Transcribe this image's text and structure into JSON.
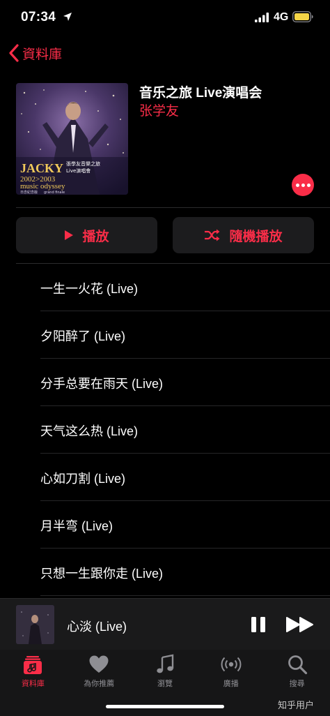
{
  "status_bar": {
    "time": "07:34",
    "network": "4G",
    "battery_color": "#f5d547"
  },
  "nav": {
    "back_label": "資料庫",
    "accent_color": "#fa2d48"
  },
  "album": {
    "title": "音乐之旅 Live演唱会",
    "artist": "张学友",
    "art_text": {
      "artist_name": "JACKY",
      "chinese_title": "張學友音樂之旅",
      "chinese_subtitle": "Live演唱會",
      "years": "2002>2003",
      "tour_name": "music odyssey",
      "edition": "日念紀念版",
      "finale": "grand finale"
    }
  },
  "actions": {
    "play_label": "播放",
    "shuffle_label": "隨機播放"
  },
  "tracks": [
    {
      "title": "一生一火花 (Live)"
    },
    {
      "title": "夕阳醉了 (Live)"
    },
    {
      "title": "分手总要在雨天 (Live)"
    },
    {
      "title": "天气这么热 (Live)"
    },
    {
      "title": "心如刀割 (Live)"
    },
    {
      "title": "月半弯 (Live)"
    },
    {
      "title": "只想一生跟你走 (Live)"
    }
  ],
  "now_playing": {
    "title": "心淡 (Live)"
  },
  "tabs": [
    {
      "label": "資料庫",
      "icon": "library-icon",
      "active": true
    },
    {
      "label": "為你推薦",
      "icon": "heart-icon",
      "active": false
    },
    {
      "label": "瀏覽",
      "icon": "music-note-icon",
      "active": false
    },
    {
      "label": "廣播",
      "icon": "radio-icon",
      "active": false
    },
    {
      "label": "搜尋",
      "icon": "search-icon",
      "active": false
    }
  ],
  "watermark": "知乎用户"
}
